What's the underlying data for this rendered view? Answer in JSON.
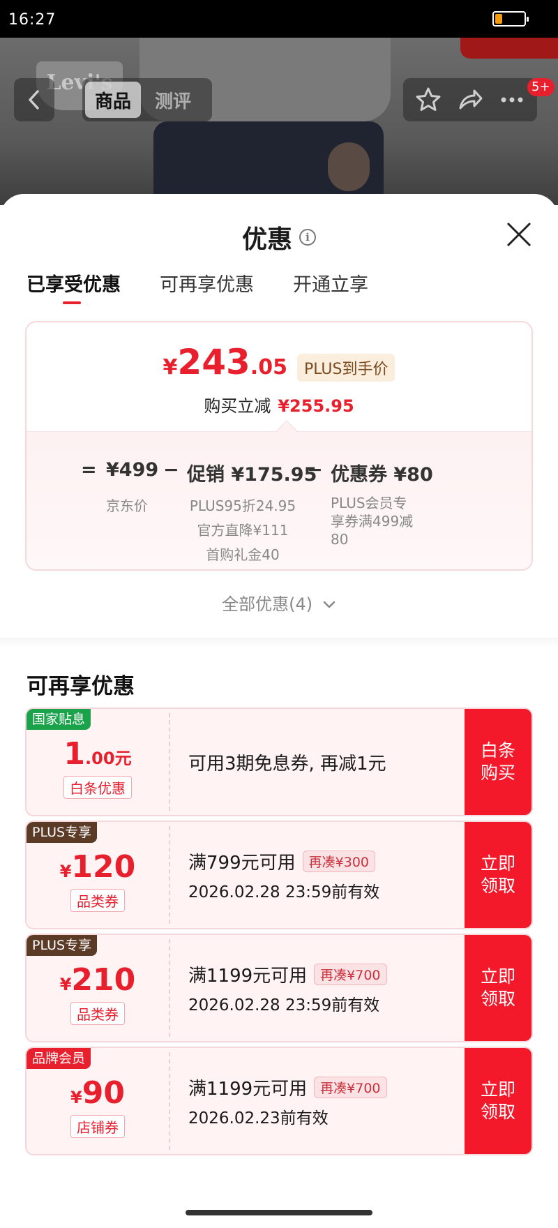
{
  "status_bar": {
    "time": "16:27",
    "battery_level": 0.25,
    "battery_color": "#f39c12"
  },
  "product_header": {
    "brand_logo": "Levi's",
    "tabs": [
      {
        "label": "商品",
        "active": true
      },
      {
        "label": "测评",
        "active": false
      }
    ],
    "badge": "5+",
    "icons": [
      "back-icon",
      "star-icon",
      "share-icon",
      "more-icon"
    ]
  },
  "sheet": {
    "title": "优惠",
    "tabs": [
      {
        "label": "已享受优惠",
        "active": true
      },
      {
        "label": "可再享优惠",
        "active": false
      },
      {
        "label": "开通立享",
        "active": false
      }
    ]
  },
  "price_card": {
    "price_yen": "¥",
    "price_int": "243",
    "price_dec": ".05",
    "plus_label": "PLUS到手价",
    "reduce_label": "购买立减",
    "reduce_amount": "¥255.95",
    "breakdown": {
      "eq": "=",
      "base_price": "¥499",
      "base_label": "京东价",
      "minus1": "−",
      "promo": "促销 ¥175.95",
      "promo_details": [
        "PLUS95折24.95",
        "官方直降¥111",
        "首购礼金40"
      ],
      "minus2": "−",
      "coupon": "优惠券 ¥80",
      "coupon_details": [
        "PLUS会员专",
        "享券满499减",
        "80"
      ]
    }
  },
  "all_offers": "全部优惠(4)",
  "section_title": "可再享优惠",
  "coupons": [
    {
      "tag": "国家贴息",
      "tag_color": "#1aa34a",
      "amount_prefix": "",
      "amount": "1",
      "amount_suffix": ".00元",
      "type": "白条优惠",
      "line1": "可用3期免息券, 再减1元",
      "pill": "",
      "line2": "",
      "action": "白条购买"
    },
    {
      "tag": "PLUS专享",
      "tag_color": "#5b3a26",
      "amount_prefix": "¥",
      "amount": "120",
      "amount_suffix": "",
      "type": "品类券",
      "line1": "满799元可用",
      "pill": "再凑¥300",
      "line2": "2026.02.28 23:59前有效",
      "action": "立即领取"
    },
    {
      "tag": "PLUS专享",
      "tag_color": "#5b3a26",
      "amount_prefix": "¥",
      "amount": "210",
      "amount_suffix": "",
      "type": "品类券",
      "line1": "满1199元可用",
      "pill": "再凑¥700",
      "line2": "2026.02.28 23:59前有效",
      "action": "立即领取"
    },
    {
      "tag": "品牌会员",
      "tag_color": "#e8202e",
      "amount_prefix": "¥",
      "amount": "90",
      "amount_suffix": "",
      "type": "店铺券",
      "line1": "满1199元可用",
      "pill": "再凑¥700",
      "line2": "2026.02.23前有效",
      "action": "立即领取"
    }
  ]
}
